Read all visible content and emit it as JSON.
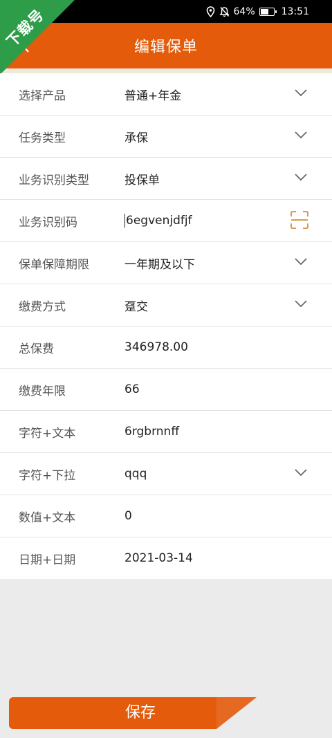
{
  "status": {
    "battery": "64%",
    "battery_level": 0.64,
    "time": "13:51"
  },
  "badge": {
    "text": "下载号"
  },
  "header": {
    "title": "编辑保单"
  },
  "rows": [
    {
      "label": "选择产品",
      "value": "普通+年金"
    },
    {
      "label": "任务类型",
      "value": "承保"
    },
    {
      "label": "业务识别类型",
      "value": "投保单"
    },
    {
      "label": "业务识别码",
      "value": "6egvenjdfjf"
    },
    {
      "label": "保单保障期限",
      "value": "一年期及以下"
    },
    {
      "label": "缴费方式",
      "value": "趸交"
    },
    {
      "label": "总保费",
      "value": "346978.00"
    },
    {
      "label": "缴费年限",
      "value": "66"
    },
    {
      "label": "字符+文本",
      "value": "6rgbrnnff"
    },
    {
      "label": "字符+下拉",
      "value": "qqq"
    },
    {
      "label": "数值+文本",
      "value": "0"
    },
    {
      "label": "日期+日期",
      "value": "2021-03-14"
    }
  ],
  "footer": {
    "save_label": "保存"
  },
  "colors": {
    "accent": "#e45b0b",
    "badge": "#2e9d4a",
    "scan_icon": "#d89a4a"
  }
}
